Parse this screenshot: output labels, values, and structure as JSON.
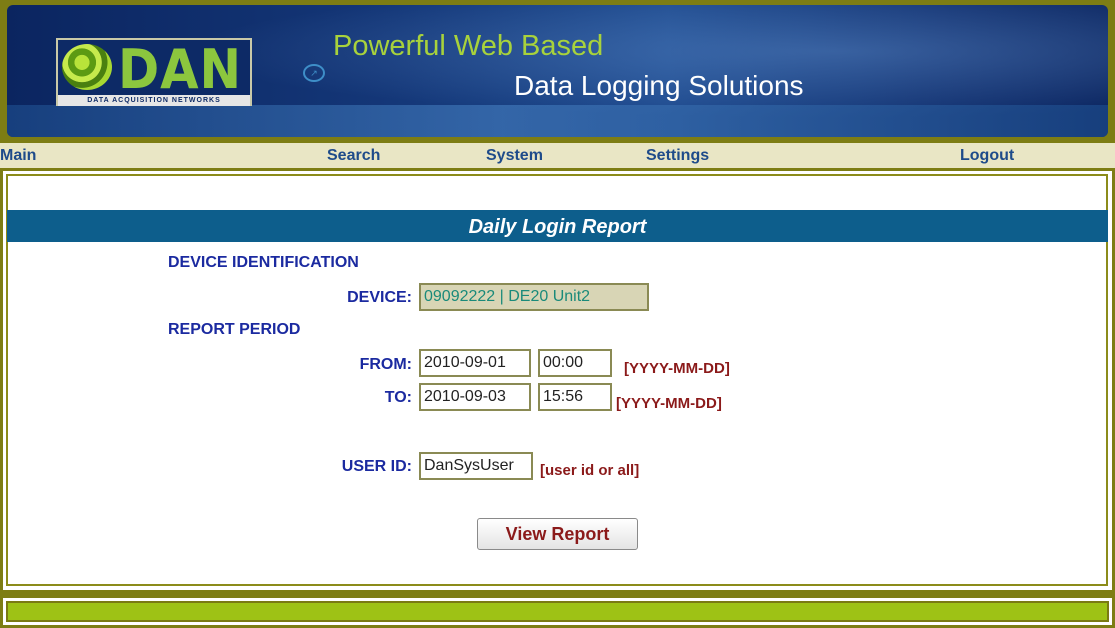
{
  "header": {
    "logo_text": "DAN",
    "logo_subtitle": "DATA ACQUISITION NETWORKS",
    "tagline_line1": "Powerful Web Based",
    "tagline_line2": "Data Logging Solutions"
  },
  "nav": {
    "main": "Main",
    "search": "Search",
    "system": "System",
    "settings": "Settings",
    "logout": "Logout"
  },
  "report": {
    "title": "Daily Login Report",
    "device_section": "DEVICE IDENTIFICATION",
    "device_label": "DEVICE:",
    "device_value": "09092222 | DE20 Unit2",
    "period_section": "REPORT PERIOD",
    "from_label": "FROM:",
    "from_date": "2010-09-01",
    "from_time": "00:00",
    "to_label": "TO:",
    "to_date": "2010-09-03",
    "to_time": "15:56",
    "date_format_hint": "[YYYY-MM-DD]",
    "user_label": "USER ID:",
    "user_value": "DanSysUser",
    "user_hint": "[user id or all]",
    "view_button": "View Report"
  },
  "colors": {
    "frame": "#7d7d14",
    "nav_bg": "#e9e6c5",
    "title_bar": "#0d5e8c",
    "label_blue": "#1b2aa0",
    "hint_red": "#8b1a1a",
    "footer_green": "#9ec215"
  }
}
